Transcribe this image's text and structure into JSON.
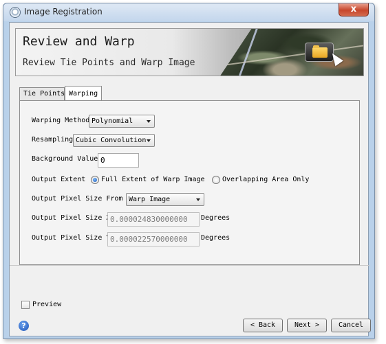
{
  "window": {
    "title": "Image Registration",
    "close_glyph": "x"
  },
  "banner": {
    "title": "Review and Warp",
    "subtitle": "Review Tie Points and Warp Image",
    "image_icon": "folder-icon"
  },
  "tabs": [
    {
      "label": "Tie Points",
      "active": false
    },
    {
      "label": "Warping",
      "active": true
    }
  ],
  "warping": {
    "method_label": "Warping Method",
    "method_value": "Polynomial",
    "resampling_label": "Resampling",
    "resampling_value": "Cubic Convolution",
    "background_label": "Background Value",
    "background_value": "0",
    "extent_label": "Output Extent",
    "extent_options": [
      {
        "label": "Full Extent of Warp Image",
        "selected": true
      },
      {
        "label": "Overlapping Area Only",
        "selected": false
      }
    ],
    "pixel_from_label": "Output Pixel Size From",
    "pixel_from_value": "Warp Image",
    "pixel_x_label": "Output Pixel Size X",
    "pixel_x_value": "0.000024830000000",
    "pixel_y_label": "Output Pixel Size Y",
    "pixel_y_value": "0.000022570000000",
    "unit": "Degrees"
  },
  "footer": {
    "preview_label": "Preview",
    "preview_checked": false,
    "help_glyph": "?",
    "back_label": "< Back",
    "next_label": "Next >",
    "cancel_label": "Cancel"
  }
}
